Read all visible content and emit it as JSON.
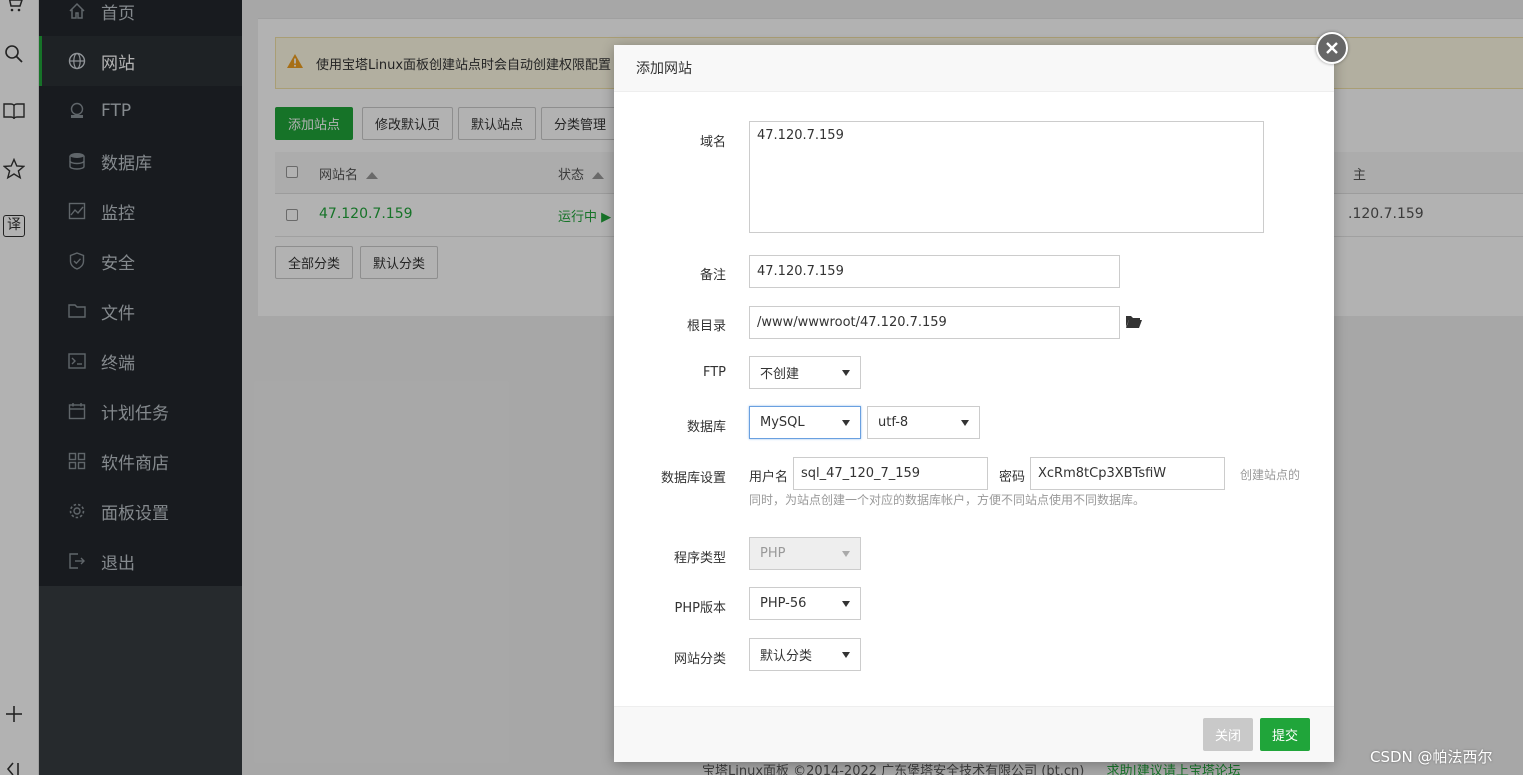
{
  "sidebar": {
    "items": [
      {
        "label": "首页",
        "icon": "home-icon"
      },
      {
        "label": "网站",
        "icon": "globe-icon"
      },
      {
        "label": "FTP",
        "icon": "ftp-icon"
      },
      {
        "label": "数据库",
        "icon": "database-icon"
      },
      {
        "label": "监控",
        "icon": "monitor-icon"
      },
      {
        "label": "安全",
        "icon": "shield-icon"
      },
      {
        "label": "文件",
        "icon": "folder-icon"
      },
      {
        "label": "终端",
        "icon": "terminal-icon"
      },
      {
        "label": "计划任务",
        "icon": "calendar-icon"
      },
      {
        "label": "软件商店",
        "icon": "apps-icon"
      },
      {
        "label": "面板设置",
        "icon": "gear-icon"
      },
      {
        "label": "退出",
        "icon": "logout-icon"
      }
    ],
    "active_index": 1
  },
  "browser_bar": {
    "translate_label": "译"
  },
  "main": {
    "alert_text": "使用宝塔Linux面板创建站点时会自动创建权限配置",
    "toolbar": {
      "add_site": "添加站点",
      "edit_default_page": "修改默认页",
      "default_site": "默认站点",
      "category_manage": "分类管理"
    },
    "table": {
      "headers": {
        "name": "网站名",
        "status": "状态",
        "right_partial": "主"
      },
      "rows": [
        {
          "name": "47.120.7.159",
          "status": "运行中",
          "right_partial": ".120.7.159"
        }
      ]
    },
    "filters": {
      "all": "全部分类",
      "default": "默认分类"
    },
    "footer": {
      "copyright": "宝塔Linux面板 ©2014-2022 广东堡塔安全技术有限公司 (bt.cn)",
      "help_link": "求助|建议请上宝塔论坛"
    }
  },
  "modal": {
    "title": "添加网站",
    "domain_label": "域名",
    "domain_value": "47.120.7.159",
    "remark_label": "备注",
    "remark_value": "47.120.7.159",
    "root_label": "根目录",
    "root_value": "/www/wwwroot/47.120.7.159",
    "ftp_label": "FTP",
    "ftp_value": "不创建",
    "db_label": "数据库",
    "db_value": "MySQL",
    "charset_value": "utf-8",
    "db_settings_label": "数据库设置",
    "db_user_label": "用户名",
    "db_user_value": "sql_47_120_7_159",
    "db_pass_label": "密码",
    "db_pass_value": "XcRm8tCp3XBTsfiW",
    "db_hint_1": "创建站点的",
    "db_hint_2": "同时，为站点创建一个对应的数据库帐户，方便不同站点使用不同数据库。",
    "program_type_label": "程序类型",
    "program_type_value": "PHP",
    "php_version_label": "PHP版本",
    "php_version_value": "PHP-56",
    "site_category_label": "网站分类",
    "site_category_value": "默认分类",
    "close_button": "关闭",
    "submit_button": "提交"
  },
  "watermark": "CSDN @帕法西尔"
}
